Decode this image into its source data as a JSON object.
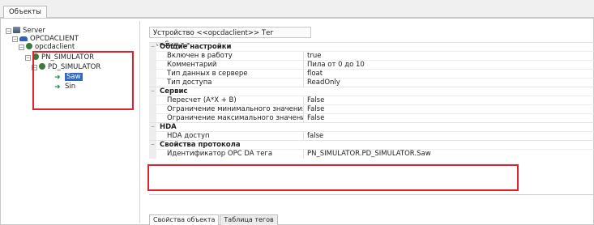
{
  "window": {
    "tab_label": "Объекты"
  },
  "tree": {
    "server": "Server",
    "client": "OPCDACLIENT",
    "client_child": "opcdaclient",
    "simulator": "PN_SIMULATOR",
    "pd_simulator": "PD_SIMULATOR",
    "tag_selected": "Saw",
    "tag_sin": "Sin"
  },
  "panel": {
    "header_title": "Устройство <<opcdaclient>> Тег  <<Saw>>",
    "categories": [
      {
        "title": "Общие настройки",
        "rows": [
          {
            "name": "Включен в работу",
            "value": "true"
          },
          {
            "name": "Комментарий",
            "value": "Пила от 0 до 10"
          },
          {
            "name": "Тип данных в сервере",
            "value": "float"
          },
          {
            "name": "Тип доступа",
            "value": "ReadOnly"
          }
        ]
      },
      {
        "title": "Сервис",
        "rows": [
          {
            "name": "Пересчет (A*X + B)",
            "value": "False"
          },
          {
            "name": "Ограничение минимального значения",
            "value": "False"
          },
          {
            "name": "Ограничение максимального значения",
            "value": "False"
          }
        ]
      },
      {
        "title": "HDA",
        "rows": [
          {
            "name": "HDA доступ",
            "value": "false"
          }
        ]
      },
      {
        "title": "Свойства протокола",
        "rows": [
          {
            "name": "Идентификатор OPC DA тега",
            "value": "PN_SIMULATOR.PD_SIMULATOR.Saw"
          }
        ]
      }
    ]
  },
  "bottom_tabs": [
    "Свойства объекта",
    "Таблица тегов"
  ],
  "colors": {
    "highlight_box": "#e0202b",
    "selection": "#316ac5"
  }
}
